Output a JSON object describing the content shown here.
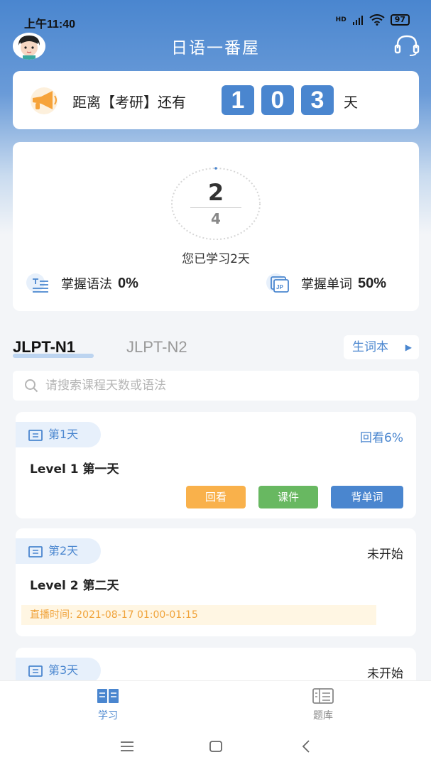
{
  "status_bar": {
    "time": "上午11:40",
    "signal": "HD",
    "battery": "97"
  },
  "header": {
    "title": "日语一番屋"
  },
  "countdown": {
    "prefix": "距离【考研】还有",
    "digits": [
      "1",
      "0",
      "3"
    ],
    "unit": "天"
  },
  "progress": {
    "studied": "2",
    "total": "4",
    "study_days_text": "您已学习2天",
    "grammar_label": "掌握语法",
    "grammar_pct": "0%",
    "words_label": "掌握单词",
    "words_pct": "50%"
  },
  "tabs": {
    "n1": "JLPT-N1",
    "n2": "JLPT-N2",
    "vocab_book": "生词本"
  },
  "search": {
    "placeholder": "请搜索课程天数或语法",
    "value": ""
  },
  "lessons": [
    {
      "day": "第1天",
      "status": "回看6%",
      "level": "Level 1  第一天",
      "actions": {
        "review": "回看",
        "courseware": "课件",
        "words": "背单词"
      }
    },
    {
      "day": "第2天",
      "status": "未开始",
      "level": "Level 2  第二天",
      "live_time": "直播时间: 2021-08-17 01:00-01:15"
    },
    {
      "day": "第3天",
      "status": "未开始"
    }
  ],
  "bottom_nav": {
    "study": "学习",
    "bank": "题库"
  },
  "colors": {
    "primary": "#4a86cf",
    "orange": "#f9b14b",
    "green": "#68b861"
  }
}
